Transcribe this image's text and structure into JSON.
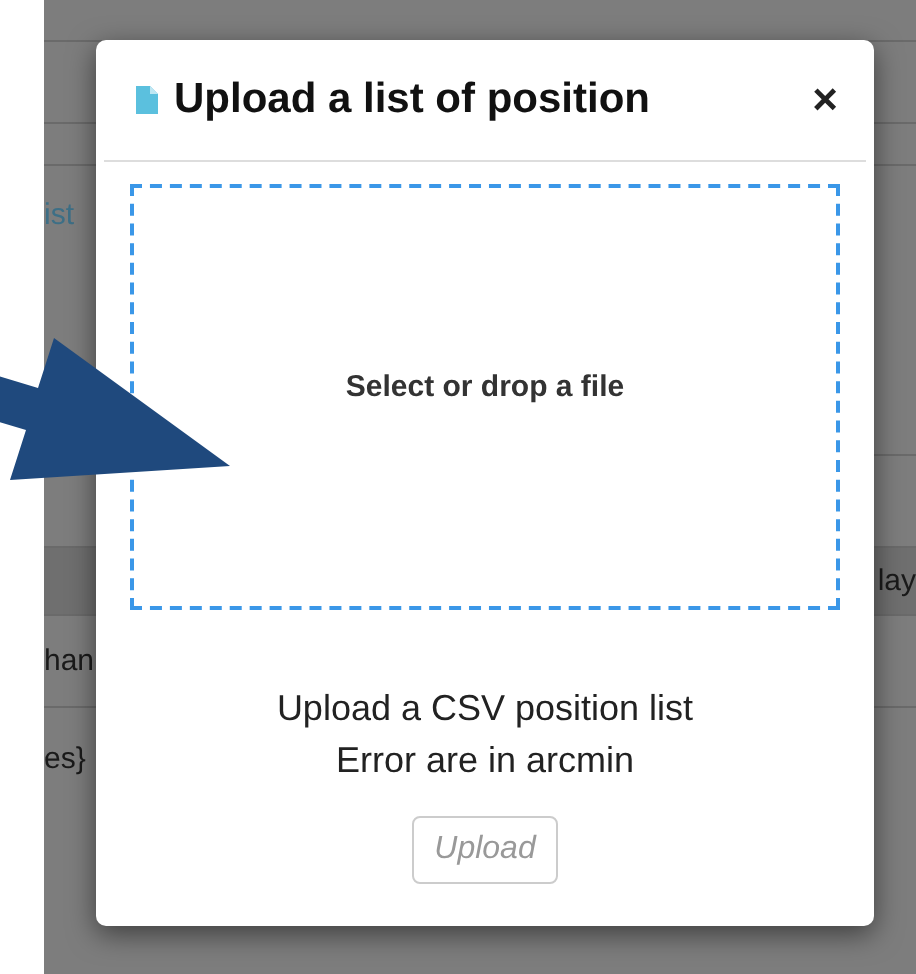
{
  "background": {
    "fragments": [
      "ist",
      "lay",
      "han",
      "es}"
    ]
  },
  "dialog": {
    "title": "Upload a list of position",
    "close": "×",
    "dropzone": {
      "label": "Select or drop a file"
    },
    "lines": [
      "Upload a CSV position list",
      "Error are in arcmin"
    ],
    "upload_button": {
      "label": "Upload",
      "disabled": true
    }
  }
}
